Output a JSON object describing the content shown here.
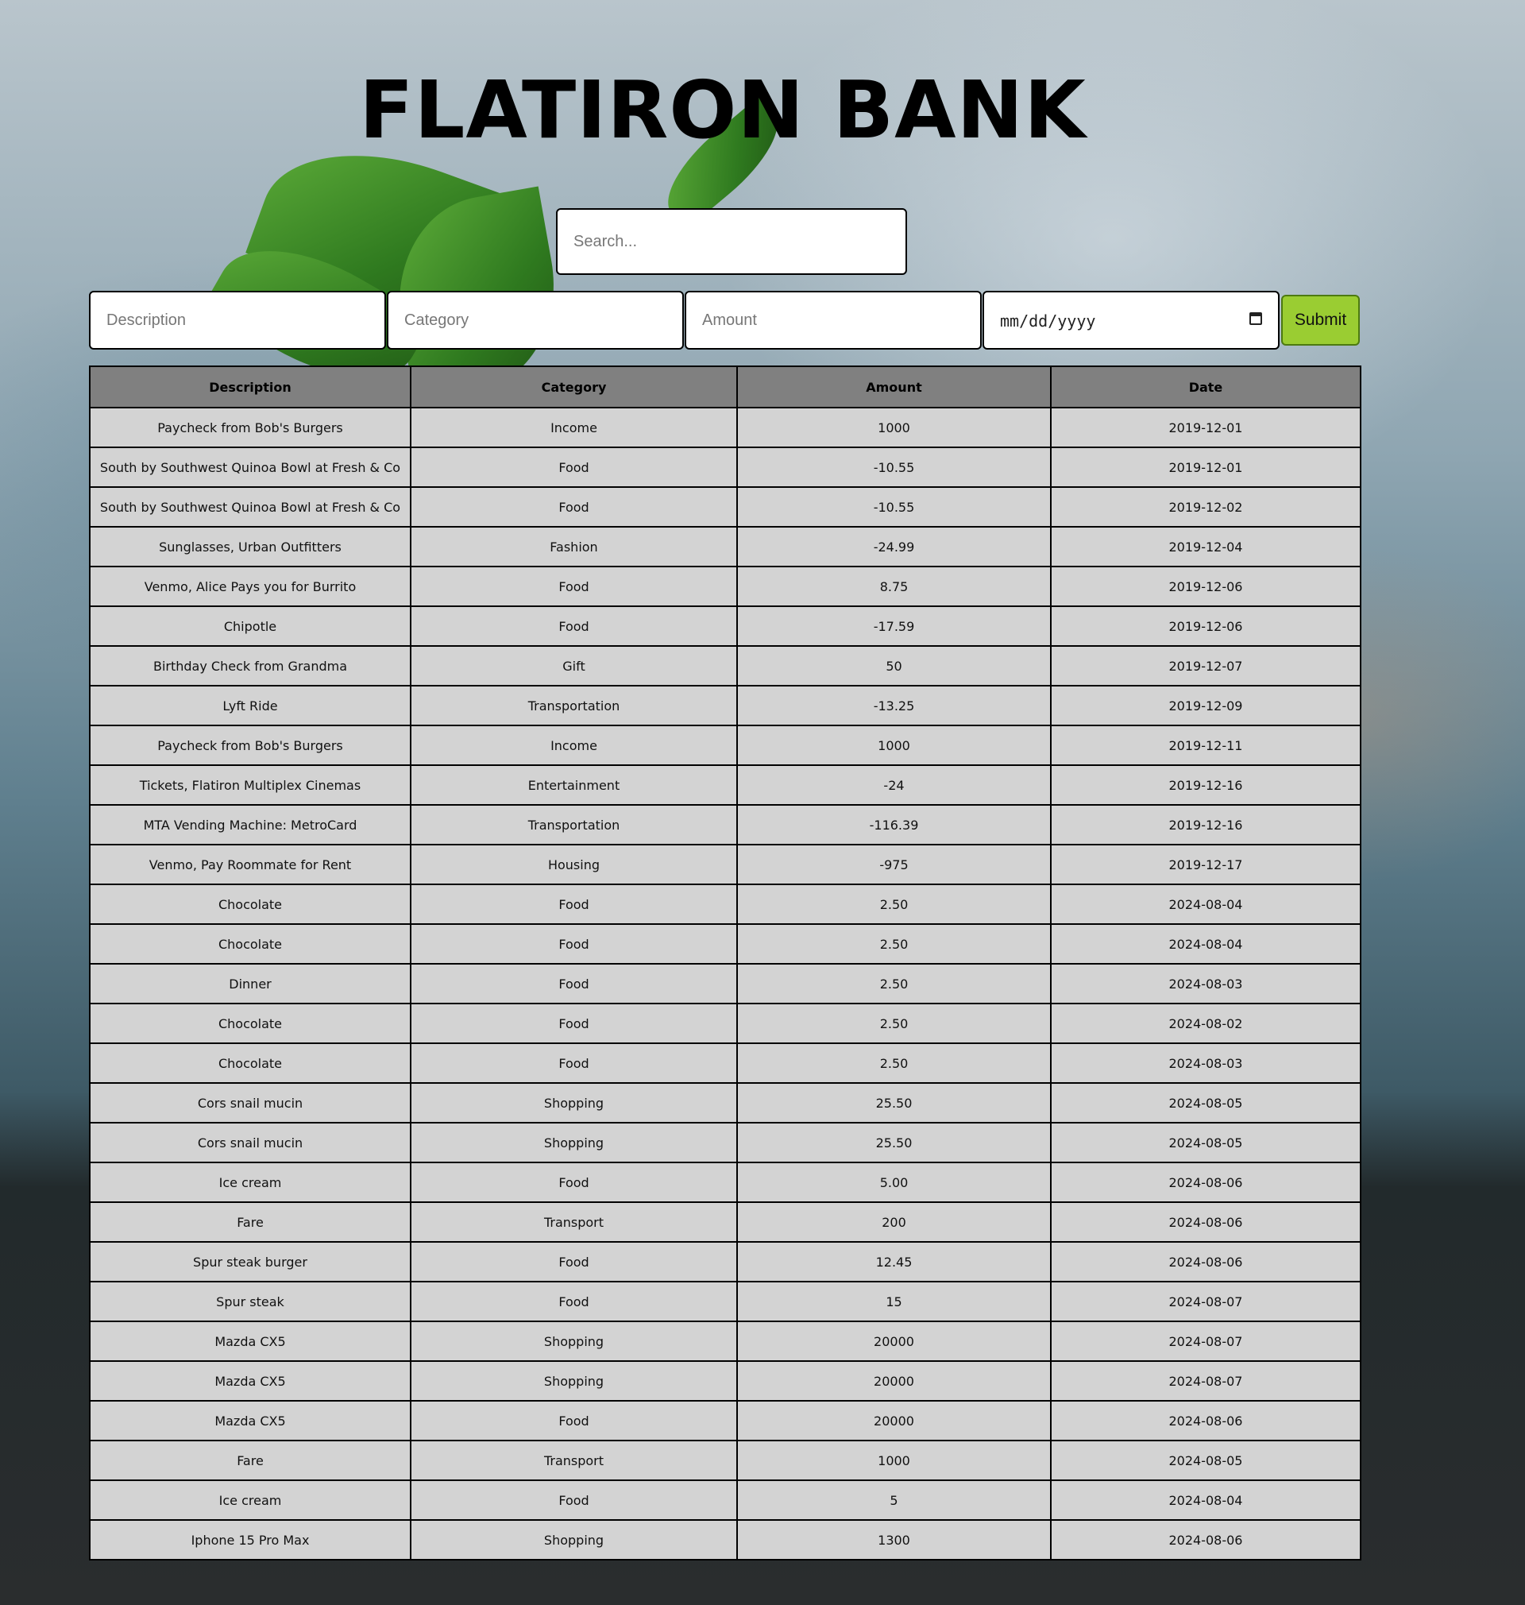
{
  "header": {
    "title": "FLATIRON BANK"
  },
  "search": {
    "placeholder": "Search..."
  },
  "form": {
    "description_placeholder": "Description",
    "category_placeholder": "Category",
    "amount_placeholder": "Amount",
    "date_placeholder": "mm/dd/yyyy",
    "submit_label": "Submit"
  },
  "table": {
    "headers": [
      "Description",
      "Category",
      "Amount",
      "Date"
    ],
    "rows": [
      [
        "Paycheck from Bob's Burgers",
        "Income",
        "1000",
        "2019-12-01"
      ],
      [
        "South by Southwest Quinoa Bowl at Fresh & Co",
        "Food",
        "-10.55",
        "2019-12-01"
      ],
      [
        "South by Southwest Quinoa Bowl at Fresh & Co",
        "Food",
        "-10.55",
        "2019-12-02"
      ],
      [
        "Sunglasses, Urban Outfitters",
        "Fashion",
        "-24.99",
        "2019-12-04"
      ],
      [
        "Venmo, Alice Pays you for Burrito",
        "Food",
        "8.75",
        "2019-12-06"
      ],
      [
        "Chipotle",
        "Food",
        "-17.59",
        "2019-12-06"
      ],
      [
        "Birthday Check from Grandma",
        "Gift",
        "50",
        "2019-12-07"
      ],
      [
        "Lyft Ride",
        "Transportation",
        "-13.25",
        "2019-12-09"
      ],
      [
        "Paycheck from Bob's Burgers",
        "Income",
        "1000",
        "2019-12-11"
      ],
      [
        "Tickets, Flatiron Multiplex Cinemas",
        "Entertainment",
        "-24",
        "2019-12-16"
      ],
      [
        "MTA Vending Machine: MetroCard",
        "Transportation",
        "-116.39",
        "2019-12-16"
      ],
      [
        "Venmo, Pay Roommate for Rent",
        "Housing",
        "-975",
        "2019-12-17"
      ],
      [
        "Chocolate",
        "Food",
        "2.50",
        "2024-08-04"
      ],
      [
        "Chocolate",
        "Food",
        "2.50",
        "2024-08-04"
      ],
      [
        "Dinner",
        "Food",
        "2.50",
        "2024-08-03"
      ],
      [
        "Chocolate",
        "Food",
        "2.50",
        "2024-08-02"
      ],
      [
        "Chocolate",
        "Food",
        "2.50",
        "2024-08-03"
      ],
      [
        "Cors snail mucin",
        "Shopping",
        "25.50",
        "2024-08-05"
      ],
      [
        "Cors snail mucin",
        "Shopping",
        "25.50",
        "2024-08-05"
      ],
      [
        "Ice cream",
        "Food",
        "5.00",
        "2024-08-06"
      ],
      [
        "Fare",
        "Transport",
        "200",
        "2024-08-06"
      ],
      [
        "Spur steak burger",
        "Food",
        "12.45",
        "2024-08-06"
      ],
      [
        "Spur steak",
        "Food",
        "15",
        "2024-08-07"
      ],
      [
        "Mazda CX5",
        "Shopping",
        "20000",
        "2024-08-07"
      ],
      [
        "Mazda CX5",
        "Shopping",
        "20000",
        "2024-08-07"
      ],
      [
        "Mazda CX5",
        "Food",
        "20000",
        "2024-08-06"
      ],
      [
        "Fare",
        "Transport",
        "1000",
        "2024-08-05"
      ],
      [
        "Ice cream",
        "Food",
        "5",
        "2024-08-04"
      ],
      [
        "Iphone 15 Pro Max",
        "Shopping",
        "1300",
        "2024-08-06"
      ]
    ]
  }
}
